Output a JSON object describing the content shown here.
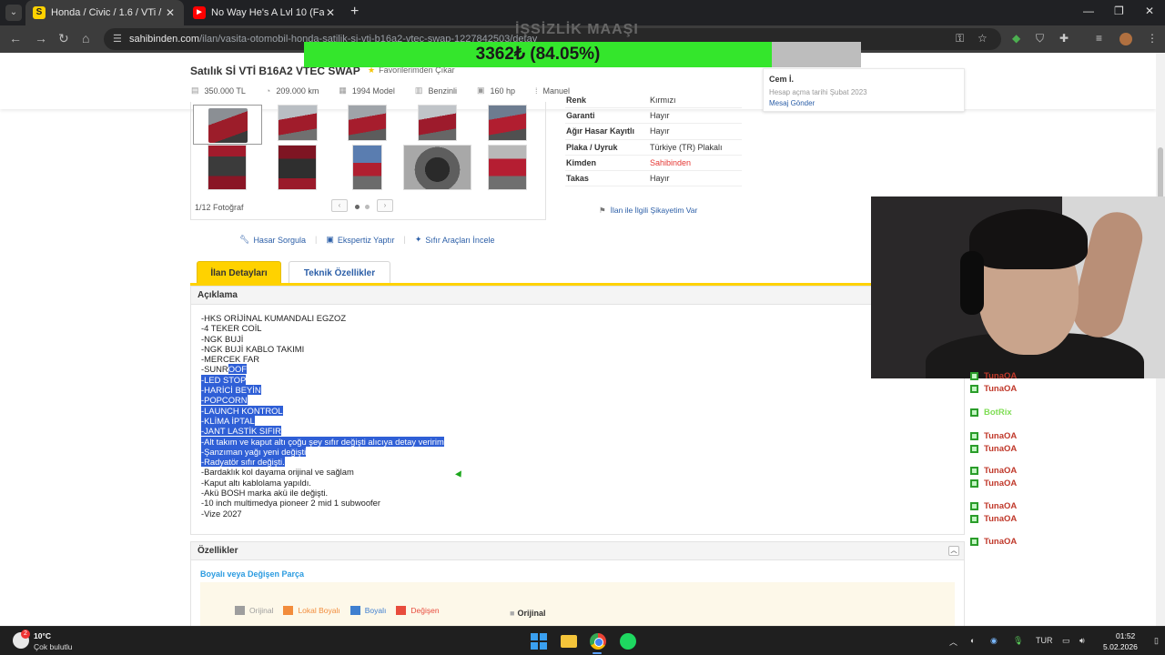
{
  "browser": {
    "tabs": [
      {
        "title": "Honda / Civic / 1.6 / VTi / Satılık",
        "favicon": "sahibinden-favicon",
        "active": true
      },
      {
        "title": "No Way He's A Lvl 10 (Faceit G",
        "favicon": "youtube-favicon",
        "active": false
      }
    ],
    "url_host": "sahibinden.com",
    "url_path": "/ilan/vasita-otomobil-honda-satilik-si-vti-b16a2-vtec-swap-1227842503/detay"
  },
  "overlay": {
    "progress_text": "3362₺ (84.05%)",
    "progress_value": 0.8405,
    "caption": "İŞSİZLİK MAAŞI",
    "fill_color": "#34e62c"
  },
  "listing": {
    "title": "Satılık Sİ VTİ B16A2 VTEC SWAP",
    "favorite_label": "Favorilerimden Çıkar",
    "specs": [
      {
        "icon": "price-tag-icon",
        "value": "350.000 TL"
      },
      {
        "icon": "speedometer-icon",
        "value": "209.000 km"
      },
      {
        "icon": "calendar-icon",
        "value": "1994 Model"
      },
      {
        "icon": "fuel-icon",
        "value": "Benzinli"
      },
      {
        "icon": "engine-icon",
        "value": "160 hp"
      },
      {
        "icon": "gearbox-icon",
        "value": "Manuel"
      }
    ]
  },
  "seller": {
    "name": "Cem İ.",
    "since": "Hesap açma tarihi  Şubat 2023",
    "message": "Mesaj Gönder"
  },
  "gallery": {
    "count": "1/12 Fotoğraf"
  },
  "info_rows": [
    {
      "key": "Renk",
      "value": "Kırmızı"
    },
    {
      "key": "Garanti",
      "value": "Hayır"
    },
    {
      "key": "Ağır Hasar Kayıtlı",
      "value": "Hayır"
    },
    {
      "key": "Plaka / Uyruk",
      "value": "Türkiye (TR) Plakalı"
    },
    {
      "key": "Kimden",
      "value": "Sahibinden",
      "accent": true
    },
    {
      "key": "Takas",
      "value": "Hayır"
    }
  ],
  "complaint": "İlan ile İlgili Şikayetim Var",
  "actions": [
    "Hasar Sorgula",
    "Ekspertiz Yaptır",
    "Sıfır Araçları İncele"
  ],
  "page_tabs": [
    "İlan Detayları",
    "Teknik Özellikler"
  ],
  "description": {
    "heading": "Açıklama",
    "lines": [
      {
        "plain": "-HKS ORİJİNAL KUMANDALI EGZOZ",
        "sel": ""
      },
      {
        "plain": "-4 TEKER COİL",
        "sel": ""
      },
      {
        "plain": "-NGK BUJİ",
        "sel": ""
      },
      {
        "plain": "-NGK BUJİ KABLO TAKIMI",
        "sel": ""
      },
      {
        "plain": "-MERCEK FAR",
        "sel": ""
      },
      {
        "plain": "-SUNR",
        "sel": "OOF"
      },
      {
        "plain": "",
        "sel": "-LED STOP"
      },
      {
        "plain": "",
        "sel": "-HARİCİ BEYİN"
      },
      {
        "plain": "",
        "sel": "-POPCORN"
      },
      {
        "plain": "",
        "sel": "-LAUNCH KONTROL"
      },
      {
        "plain": "",
        "sel": "-KLİMA İPTAL"
      },
      {
        "plain": "",
        "sel": "-JANT LASTİK SIFIR"
      },
      {
        "plain": "",
        "sel": "-Alt takım ve kaput altı çoğu şey sıfır değişti alıcıya detay veririm"
      },
      {
        "plain": "",
        "sel": "-Şanzıman yağı yeni değişti"
      },
      {
        "plain": "",
        "sel": "-Radyatör sıfır değişti."
      },
      {
        "plain": "-Bardaklık kol dayama orijinal ve sağlam",
        "sel": ""
      },
      {
        "plain": "-Kaput altı kablolama yapıldı.",
        "sel": ""
      },
      {
        "plain": "-Akü BOSH marka akü ile değişti.",
        "sel": ""
      },
      {
        "plain": "-10 inch multimedya pioneer 2 mid 1 subwoofer",
        "sel": ""
      },
      {
        "plain": "-Vize 2027",
        "sel": ""
      }
    ]
  },
  "features": {
    "heading": "Özellikler",
    "parts_link": "Boyalı veya Değişen Parça",
    "legend": [
      {
        "label": "Orijinal",
        "color": "#9e9e9e",
        "text_color": "#9e9e9e"
      },
      {
        "label": "Lokal Boyalı",
        "color": "#f28c3c",
        "text_color": "#f28c3c"
      },
      {
        "label": "Boyalı",
        "color": "#3f7fd0",
        "text_color": "#3f7fd0"
      },
      {
        "label": "Değişen",
        "color": "#e84c3d",
        "text_color": "#e84c3d"
      }
    ],
    "original_label": "Orijinal"
  },
  "chat": [
    {
      "user": "TunaOA",
      "text": "",
      "text2": ""
    },
    {
      "user": "TunaOA",
      "text": "",
      "text2": ""
    },
    {
      "user": "BotRix",
      "text": "",
      "text2": "",
      "bot": true
    },
    {
      "user": "TunaOA",
      "text": "",
      "text2": ""
    },
    {
      "user": "TunaOA",
      "text": "",
      "text2": ""
    },
    {
      "user": "TunaOA",
      "text": "",
      "text2": ""
    },
    {
      "user": "TunaOA",
      "text": "",
      "text2": ""
    },
    {
      "user": "TunaOA",
      "text": "",
      "text2": ""
    },
    {
      "user": "TunaOA",
      "text": "",
      "text2": ""
    },
    {
      "user": "TunaOA",
      "text": "",
      "text2": ""
    }
  ],
  "taskbar": {
    "temperature": "10°C",
    "weather": "Çok bulutlu",
    "weather_badge": "2",
    "language": "TUR",
    "time": "01:52",
    "date": "5.02.2026"
  }
}
